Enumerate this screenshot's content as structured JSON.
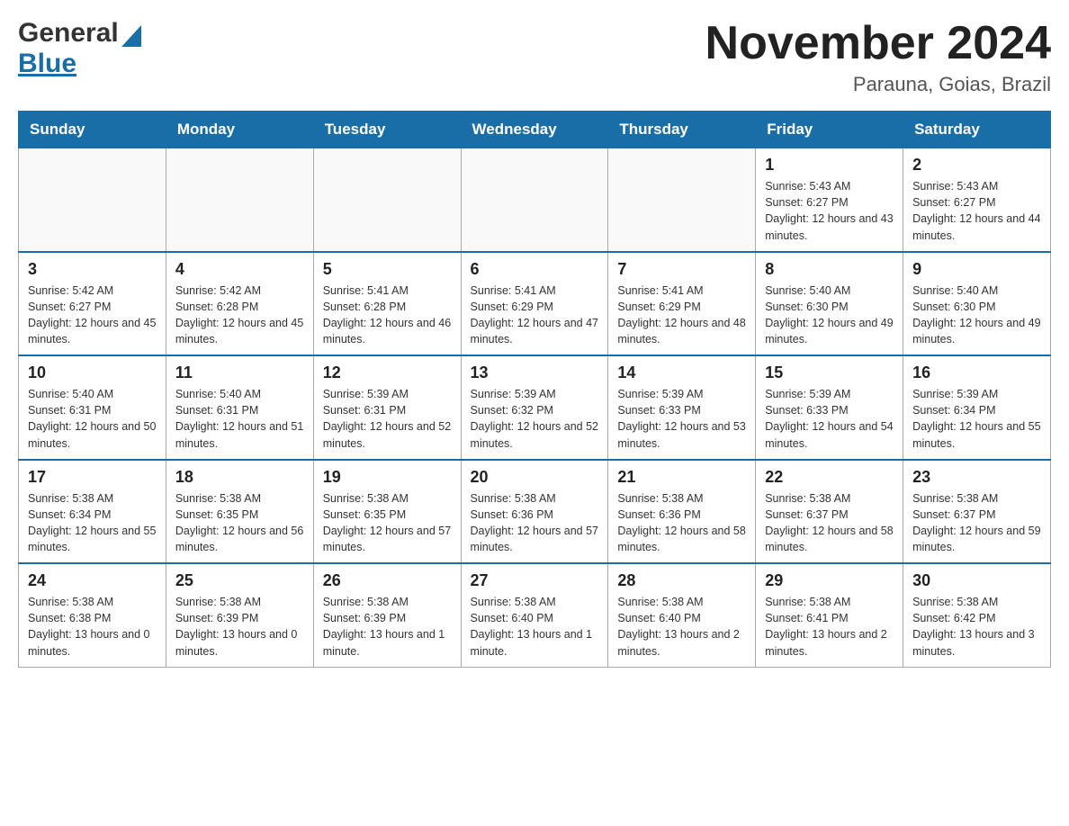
{
  "header": {
    "logo_general": "General",
    "logo_blue": "Blue",
    "title": "November 2024",
    "subtitle": "Parauna, Goias, Brazil"
  },
  "weekdays": [
    "Sunday",
    "Monday",
    "Tuesday",
    "Wednesday",
    "Thursday",
    "Friday",
    "Saturday"
  ],
  "weeks": [
    [
      {
        "day": "",
        "info": ""
      },
      {
        "day": "",
        "info": ""
      },
      {
        "day": "",
        "info": ""
      },
      {
        "day": "",
        "info": ""
      },
      {
        "day": "",
        "info": ""
      },
      {
        "day": "1",
        "info": "Sunrise: 5:43 AM\nSunset: 6:27 PM\nDaylight: 12 hours and 43 minutes."
      },
      {
        "day": "2",
        "info": "Sunrise: 5:43 AM\nSunset: 6:27 PM\nDaylight: 12 hours and 44 minutes."
      }
    ],
    [
      {
        "day": "3",
        "info": "Sunrise: 5:42 AM\nSunset: 6:27 PM\nDaylight: 12 hours and 45 minutes."
      },
      {
        "day": "4",
        "info": "Sunrise: 5:42 AM\nSunset: 6:28 PM\nDaylight: 12 hours and 45 minutes."
      },
      {
        "day": "5",
        "info": "Sunrise: 5:41 AM\nSunset: 6:28 PM\nDaylight: 12 hours and 46 minutes."
      },
      {
        "day": "6",
        "info": "Sunrise: 5:41 AM\nSunset: 6:29 PM\nDaylight: 12 hours and 47 minutes."
      },
      {
        "day": "7",
        "info": "Sunrise: 5:41 AM\nSunset: 6:29 PM\nDaylight: 12 hours and 48 minutes."
      },
      {
        "day": "8",
        "info": "Sunrise: 5:40 AM\nSunset: 6:30 PM\nDaylight: 12 hours and 49 minutes."
      },
      {
        "day": "9",
        "info": "Sunrise: 5:40 AM\nSunset: 6:30 PM\nDaylight: 12 hours and 49 minutes."
      }
    ],
    [
      {
        "day": "10",
        "info": "Sunrise: 5:40 AM\nSunset: 6:31 PM\nDaylight: 12 hours and 50 minutes."
      },
      {
        "day": "11",
        "info": "Sunrise: 5:40 AM\nSunset: 6:31 PM\nDaylight: 12 hours and 51 minutes."
      },
      {
        "day": "12",
        "info": "Sunrise: 5:39 AM\nSunset: 6:31 PM\nDaylight: 12 hours and 52 minutes."
      },
      {
        "day": "13",
        "info": "Sunrise: 5:39 AM\nSunset: 6:32 PM\nDaylight: 12 hours and 52 minutes."
      },
      {
        "day": "14",
        "info": "Sunrise: 5:39 AM\nSunset: 6:33 PM\nDaylight: 12 hours and 53 minutes."
      },
      {
        "day": "15",
        "info": "Sunrise: 5:39 AM\nSunset: 6:33 PM\nDaylight: 12 hours and 54 minutes."
      },
      {
        "day": "16",
        "info": "Sunrise: 5:39 AM\nSunset: 6:34 PM\nDaylight: 12 hours and 55 minutes."
      }
    ],
    [
      {
        "day": "17",
        "info": "Sunrise: 5:38 AM\nSunset: 6:34 PM\nDaylight: 12 hours and 55 minutes."
      },
      {
        "day": "18",
        "info": "Sunrise: 5:38 AM\nSunset: 6:35 PM\nDaylight: 12 hours and 56 minutes."
      },
      {
        "day": "19",
        "info": "Sunrise: 5:38 AM\nSunset: 6:35 PM\nDaylight: 12 hours and 57 minutes."
      },
      {
        "day": "20",
        "info": "Sunrise: 5:38 AM\nSunset: 6:36 PM\nDaylight: 12 hours and 57 minutes."
      },
      {
        "day": "21",
        "info": "Sunrise: 5:38 AM\nSunset: 6:36 PM\nDaylight: 12 hours and 58 minutes."
      },
      {
        "day": "22",
        "info": "Sunrise: 5:38 AM\nSunset: 6:37 PM\nDaylight: 12 hours and 58 minutes."
      },
      {
        "day": "23",
        "info": "Sunrise: 5:38 AM\nSunset: 6:37 PM\nDaylight: 12 hours and 59 minutes."
      }
    ],
    [
      {
        "day": "24",
        "info": "Sunrise: 5:38 AM\nSunset: 6:38 PM\nDaylight: 13 hours and 0 minutes."
      },
      {
        "day": "25",
        "info": "Sunrise: 5:38 AM\nSunset: 6:39 PM\nDaylight: 13 hours and 0 minutes."
      },
      {
        "day": "26",
        "info": "Sunrise: 5:38 AM\nSunset: 6:39 PM\nDaylight: 13 hours and 1 minute."
      },
      {
        "day": "27",
        "info": "Sunrise: 5:38 AM\nSunset: 6:40 PM\nDaylight: 13 hours and 1 minute."
      },
      {
        "day": "28",
        "info": "Sunrise: 5:38 AM\nSunset: 6:40 PM\nDaylight: 13 hours and 2 minutes."
      },
      {
        "day": "29",
        "info": "Sunrise: 5:38 AM\nSunset: 6:41 PM\nDaylight: 13 hours and 2 minutes."
      },
      {
        "day": "30",
        "info": "Sunrise: 5:38 AM\nSunset: 6:42 PM\nDaylight: 13 hours and 3 minutes."
      }
    ]
  ],
  "accent_color": "#1a6ea8"
}
